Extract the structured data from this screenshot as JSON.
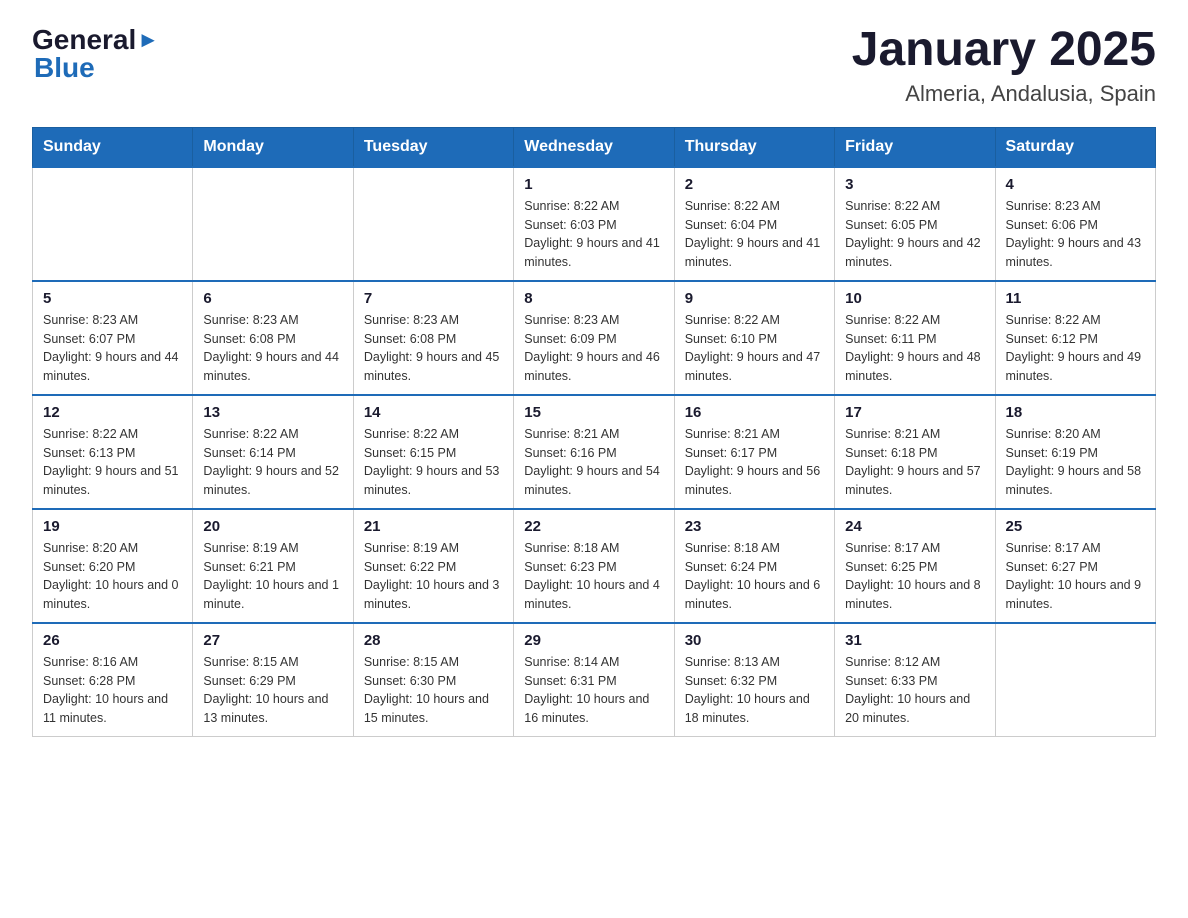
{
  "logo": {
    "general": "General",
    "blue": "Blue"
  },
  "title": "January 2025",
  "subtitle": "Almeria, Andalusia, Spain",
  "weekdays": [
    "Sunday",
    "Monday",
    "Tuesday",
    "Wednesday",
    "Thursday",
    "Friday",
    "Saturday"
  ],
  "weeks": [
    [
      {
        "day": "",
        "info": ""
      },
      {
        "day": "",
        "info": ""
      },
      {
        "day": "",
        "info": ""
      },
      {
        "day": "1",
        "info": "Sunrise: 8:22 AM\nSunset: 6:03 PM\nDaylight: 9 hours and 41 minutes."
      },
      {
        "day": "2",
        "info": "Sunrise: 8:22 AM\nSunset: 6:04 PM\nDaylight: 9 hours and 41 minutes."
      },
      {
        "day": "3",
        "info": "Sunrise: 8:22 AM\nSunset: 6:05 PM\nDaylight: 9 hours and 42 minutes."
      },
      {
        "day": "4",
        "info": "Sunrise: 8:23 AM\nSunset: 6:06 PM\nDaylight: 9 hours and 43 minutes."
      }
    ],
    [
      {
        "day": "5",
        "info": "Sunrise: 8:23 AM\nSunset: 6:07 PM\nDaylight: 9 hours and 44 minutes."
      },
      {
        "day": "6",
        "info": "Sunrise: 8:23 AM\nSunset: 6:08 PM\nDaylight: 9 hours and 44 minutes."
      },
      {
        "day": "7",
        "info": "Sunrise: 8:23 AM\nSunset: 6:08 PM\nDaylight: 9 hours and 45 minutes."
      },
      {
        "day": "8",
        "info": "Sunrise: 8:23 AM\nSunset: 6:09 PM\nDaylight: 9 hours and 46 minutes."
      },
      {
        "day": "9",
        "info": "Sunrise: 8:22 AM\nSunset: 6:10 PM\nDaylight: 9 hours and 47 minutes."
      },
      {
        "day": "10",
        "info": "Sunrise: 8:22 AM\nSunset: 6:11 PM\nDaylight: 9 hours and 48 minutes."
      },
      {
        "day": "11",
        "info": "Sunrise: 8:22 AM\nSunset: 6:12 PM\nDaylight: 9 hours and 49 minutes."
      }
    ],
    [
      {
        "day": "12",
        "info": "Sunrise: 8:22 AM\nSunset: 6:13 PM\nDaylight: 9 hours and 51 minutes."
      },
      {
        "day": "13",
        "info": "Sunrise: 8:22 AM\nSunset: 6:14 PM\nDaylight: 9 hours and 52 minutes."
      },
      {
        "day": "14",
        "info": "Sunrise: 8:22 AM\nSunset: 6:15 PM\nDaylight: 9 hours and 53 minutes."
      },
      {
        "day": "15",
        "info": "Sunrise: 8:21 AM\nSunset: 6:16 PM\nDaylight: 9 hours and 54 minutes."
      },
      {
        "day": "16",
        "info": "Sunrise: 8:21 AM\nSunset: 6:17 PM\nDaylight: 9 hours and 56 minutes."
      },
      {
        "day": "17",
        "info": "Sunrise: 8:21 AM\nSunset: 6:18 PM\nDaylight: 9 hours and 57 minutes."
      },
      {
        "day": "18",
        "info": "Sunrise: 8:20 AM\nSunset: 6:19 PM\nDaylight: 9 hours and 58 minutes."
      }
    ],
    [
      {
        "day": "19",
        "info": "Sunrise: 8:20 AM\nSunset: 6:20 PM\nDaylight: 10 hours and 0 minutes."
      },
      {
        "day": "20",
        "info": "Sunrise: 8:19 AM\nSunset: 6:21 PM\nDaylight: 10 hours and 1 minute."
      },
      {
        "day": "21",
        "info": "Sunrise: 8:19 AM\nSunset: 6:22 PM\nDaylight: 10 hours and 3 minutes."
      },
      {
        "day": "22",
        "info": "Sunrise: 8:18 AM\nSunset: 6:23 PM\nDaylight: 10 hours and 4 minutes."
      },
      {
        "day": "23",
        "info": "Sunrise: 8:18 AM\nSunset: 6:24 PM\nDaylight: 10 hours and 6 minutes."
      },
      {
        "day": "24",
        "info": "Sunrise: 8:17 AM\nSunset: 6:25 PM\nDaylight: 10 hours and 8 minutes."
      },
      {
        "day": "25",
        "info": "Sunrise: 8:17 AM\nSunset: 6:27 PM\nDaylight: 10 hours and 9 minutes."
      }
    ],
    [
      {
        "day": "26",
        "info": "Sunrise: 8:16 AM\nSunset: 6:28 PM\nDaylight: 10 hours and 11 minutes."
      },
      {
        "day": "27",
        "info": "Sunrise: 8:15 AM\nSunset: 6:29 PM\nDaylight: 10 hours and 13 minutes."
      },
      {
        "day": "28",
        "info": "Sunrise: 8:15 AM\nSunset: 6:30 PM\nDaylight: 10 hours and 15 minutes."
      },
      {
        "day": "29",
        "info": "Sunrise: 8:14 AM\nSunset: 6:31 PM\nDaylight: 10 hours and 16 minutes."
      },
      {
        "day": "30",
        "info": "Sunrise: 8:13 AM\nSunset: 6:32 PM\nDaylight: 10 hours and 18 minutes."
      },
      {
        "day": "31",
        "info": "Sunrise: 8:12 AM\nSunset: 6:33 PM\nDaylight: 10 hours and 20 minutes."
      },
      {
        "day": "",
        "info": ""
      }
    ]
  ]
}
